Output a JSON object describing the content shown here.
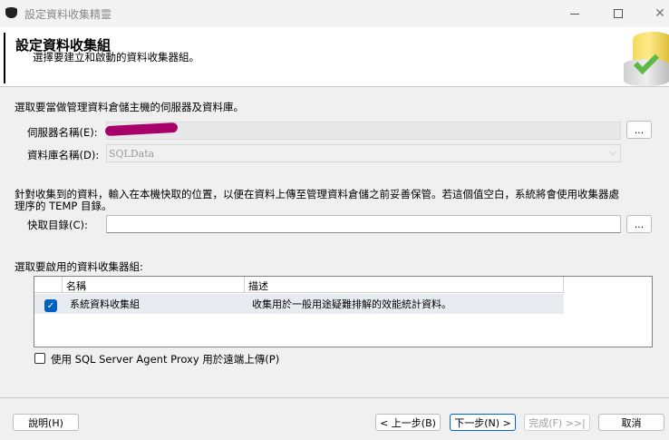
{
  "window": {
    "title": "設定資料收集精靈"
  },
  "header": {
    "title": "設定資料收集組",
    "subtitle": "選擇要建立和啟動的資料收集器組。"
  },
  "server_section": {
    "instruction": "選取要當做管理資料倉儲主機的伺服器及資料庫。",
    "server_label": "伺服器名稱(E):",
    "server_value": "",
    "database_label": "資料庫名稱(D):",
    "database_value": "SQLData",
    "browse_label": "..."
  },
  "cache_section": {
    "instruction_line1": "針對收集到的資料，輸入在本機快取的位置，以便在資料上傳至管理資料倉儲之前妥善保管。若這個值空白，系統將會使用收集器處",
    "instruction_line2": "理序的 TEMP 目錄。",
    "cache_label": "快取目錄(C):",
    "cache_value": "",
    "browse_label": "..."
  },
  "collector_section": {
    "instruction": "選取要啟用的資料收集器組:",
    "columns": [
      "名稱",
      "描述"
    ],
    "rows": [
      {
        "checked": true,
        "name": "系統資料收集組",
        "description": "收集用於一般用途疑難排解的效能統計資料。"
      }
    ],
    "proxy_label": "使用 SQL Server Agent Proxy 用於遠端上傳(P)"
  },
  "footer": {
    "help": "說明(H)",
    "back": "< 上一步(B)",
    "next": "下一步(N) >",
    "finish": "完成(F) >>|",
    "cancel": "取消"
  },
  "colors": {
    "accent": "#0067c0",
    "redaction": "#a8006b"
  }
}
